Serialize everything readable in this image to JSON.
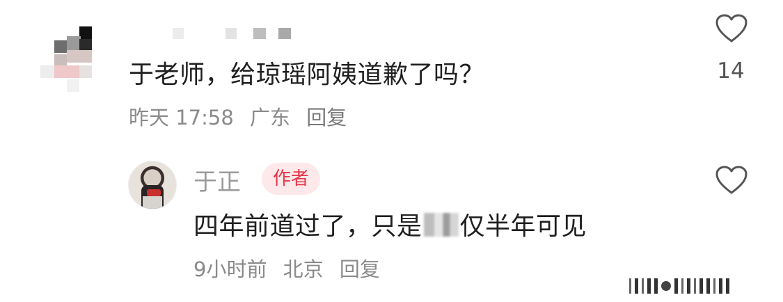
{
  "comment": {
    "text": "于老师，给琼瑶阿姨道歉了吗？",
    "time": "昨天 17:58",
    "location": "广东",
    "reply_label": "回复",
    "like_count": "14",
    "like_icon": "heart-outline-icon"
  },
  "reply": {
    "author": "于正",
    "badge": "作者",
    "text_before": "四年前道过了，只是",
    "text_after": "仅半年可见",
    "time": "9小时前",
    "location": "北京",
    "reply_label": "回复",
    "like_icon": "heart-outline-icon"
  },
  "colors": {
    "badge_bg": "#fde9ea",
    "badge_text": "#e8364a",
    "meta_text": "#8a8a8a"
  }
}
